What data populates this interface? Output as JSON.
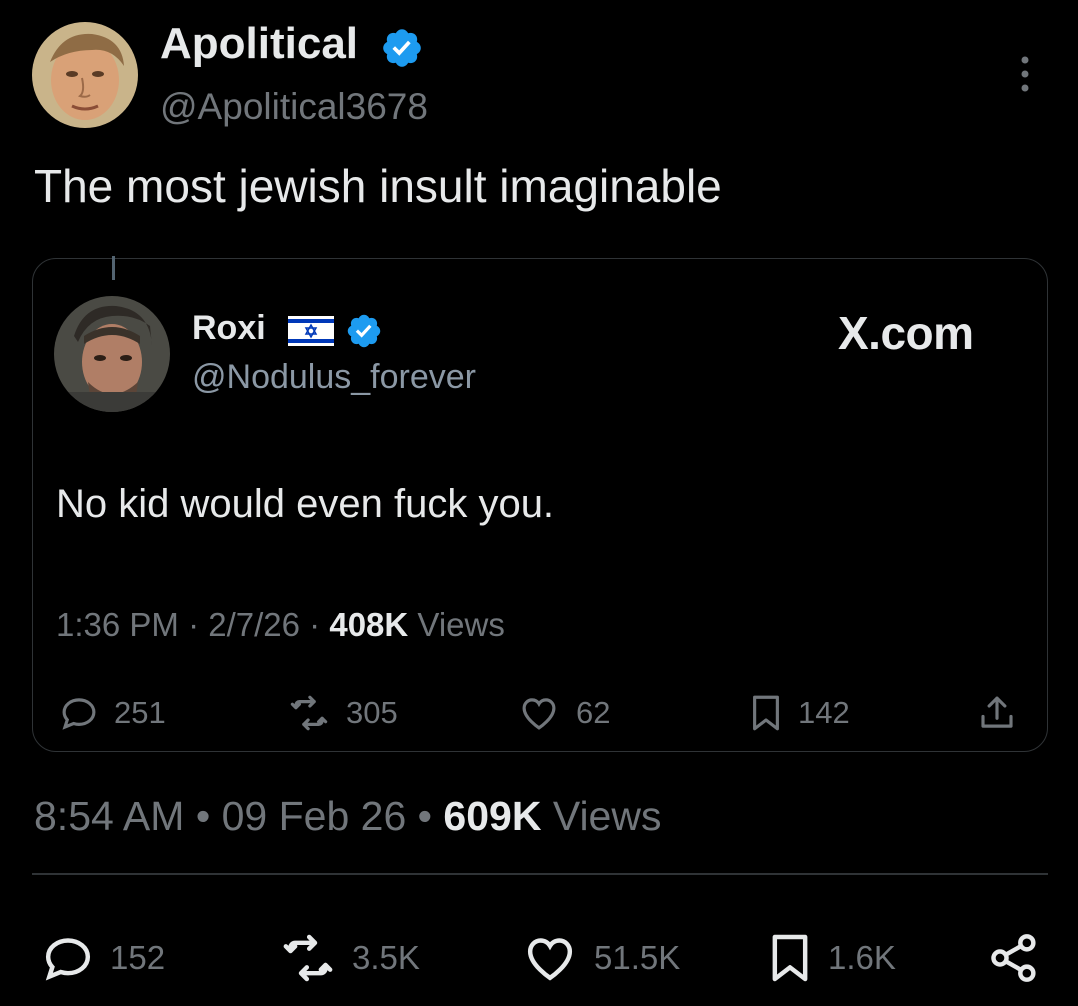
{
  "author": {
    "name": "Apolitical",
    "handle": "@Apolitical3678",
    "verified": true
  },
  "tweet": {
    "text": "The most jewish insult imaginable",
    "time": "8:54 AM",
    "date": "09 Feb 26",
    "views_count": "609K",
    "views_label": "Views",
    "separator": "•",
    "stats": {
      "replies": "152",
      "reposts": "3.5K",
      "likes": "51.5K",
      "bookmarks": "1.6K"
    }
  },
  "embedded_tweet": {
    "name": "Roxi",
    "flag": "israel-flag",
    "verified": true,
    "handle": "@Nodulus_forever",
    "source_logo": "X.com",
    "text": "No kid would even fuck you.",
    "time": "1:36 PM",
    "date": "2/7/26",
    "views_count": "408K",
    "views_label": "Views",
    "separator": "·",
    "stats": {
      "replies": "251",
      "reposts": "305",
      "likes": "62",
      "bookmarks": "142"
    }
  },
  "colors": {
    "background": "#000000",
    "text_primary": "#e7e9ea",
    "text_secondary": "#71767b",
    "border": "#2f3336",
    "verified_blue": "#1d9bf0",
    "flag_blue": "#0038b8"
  }
}
